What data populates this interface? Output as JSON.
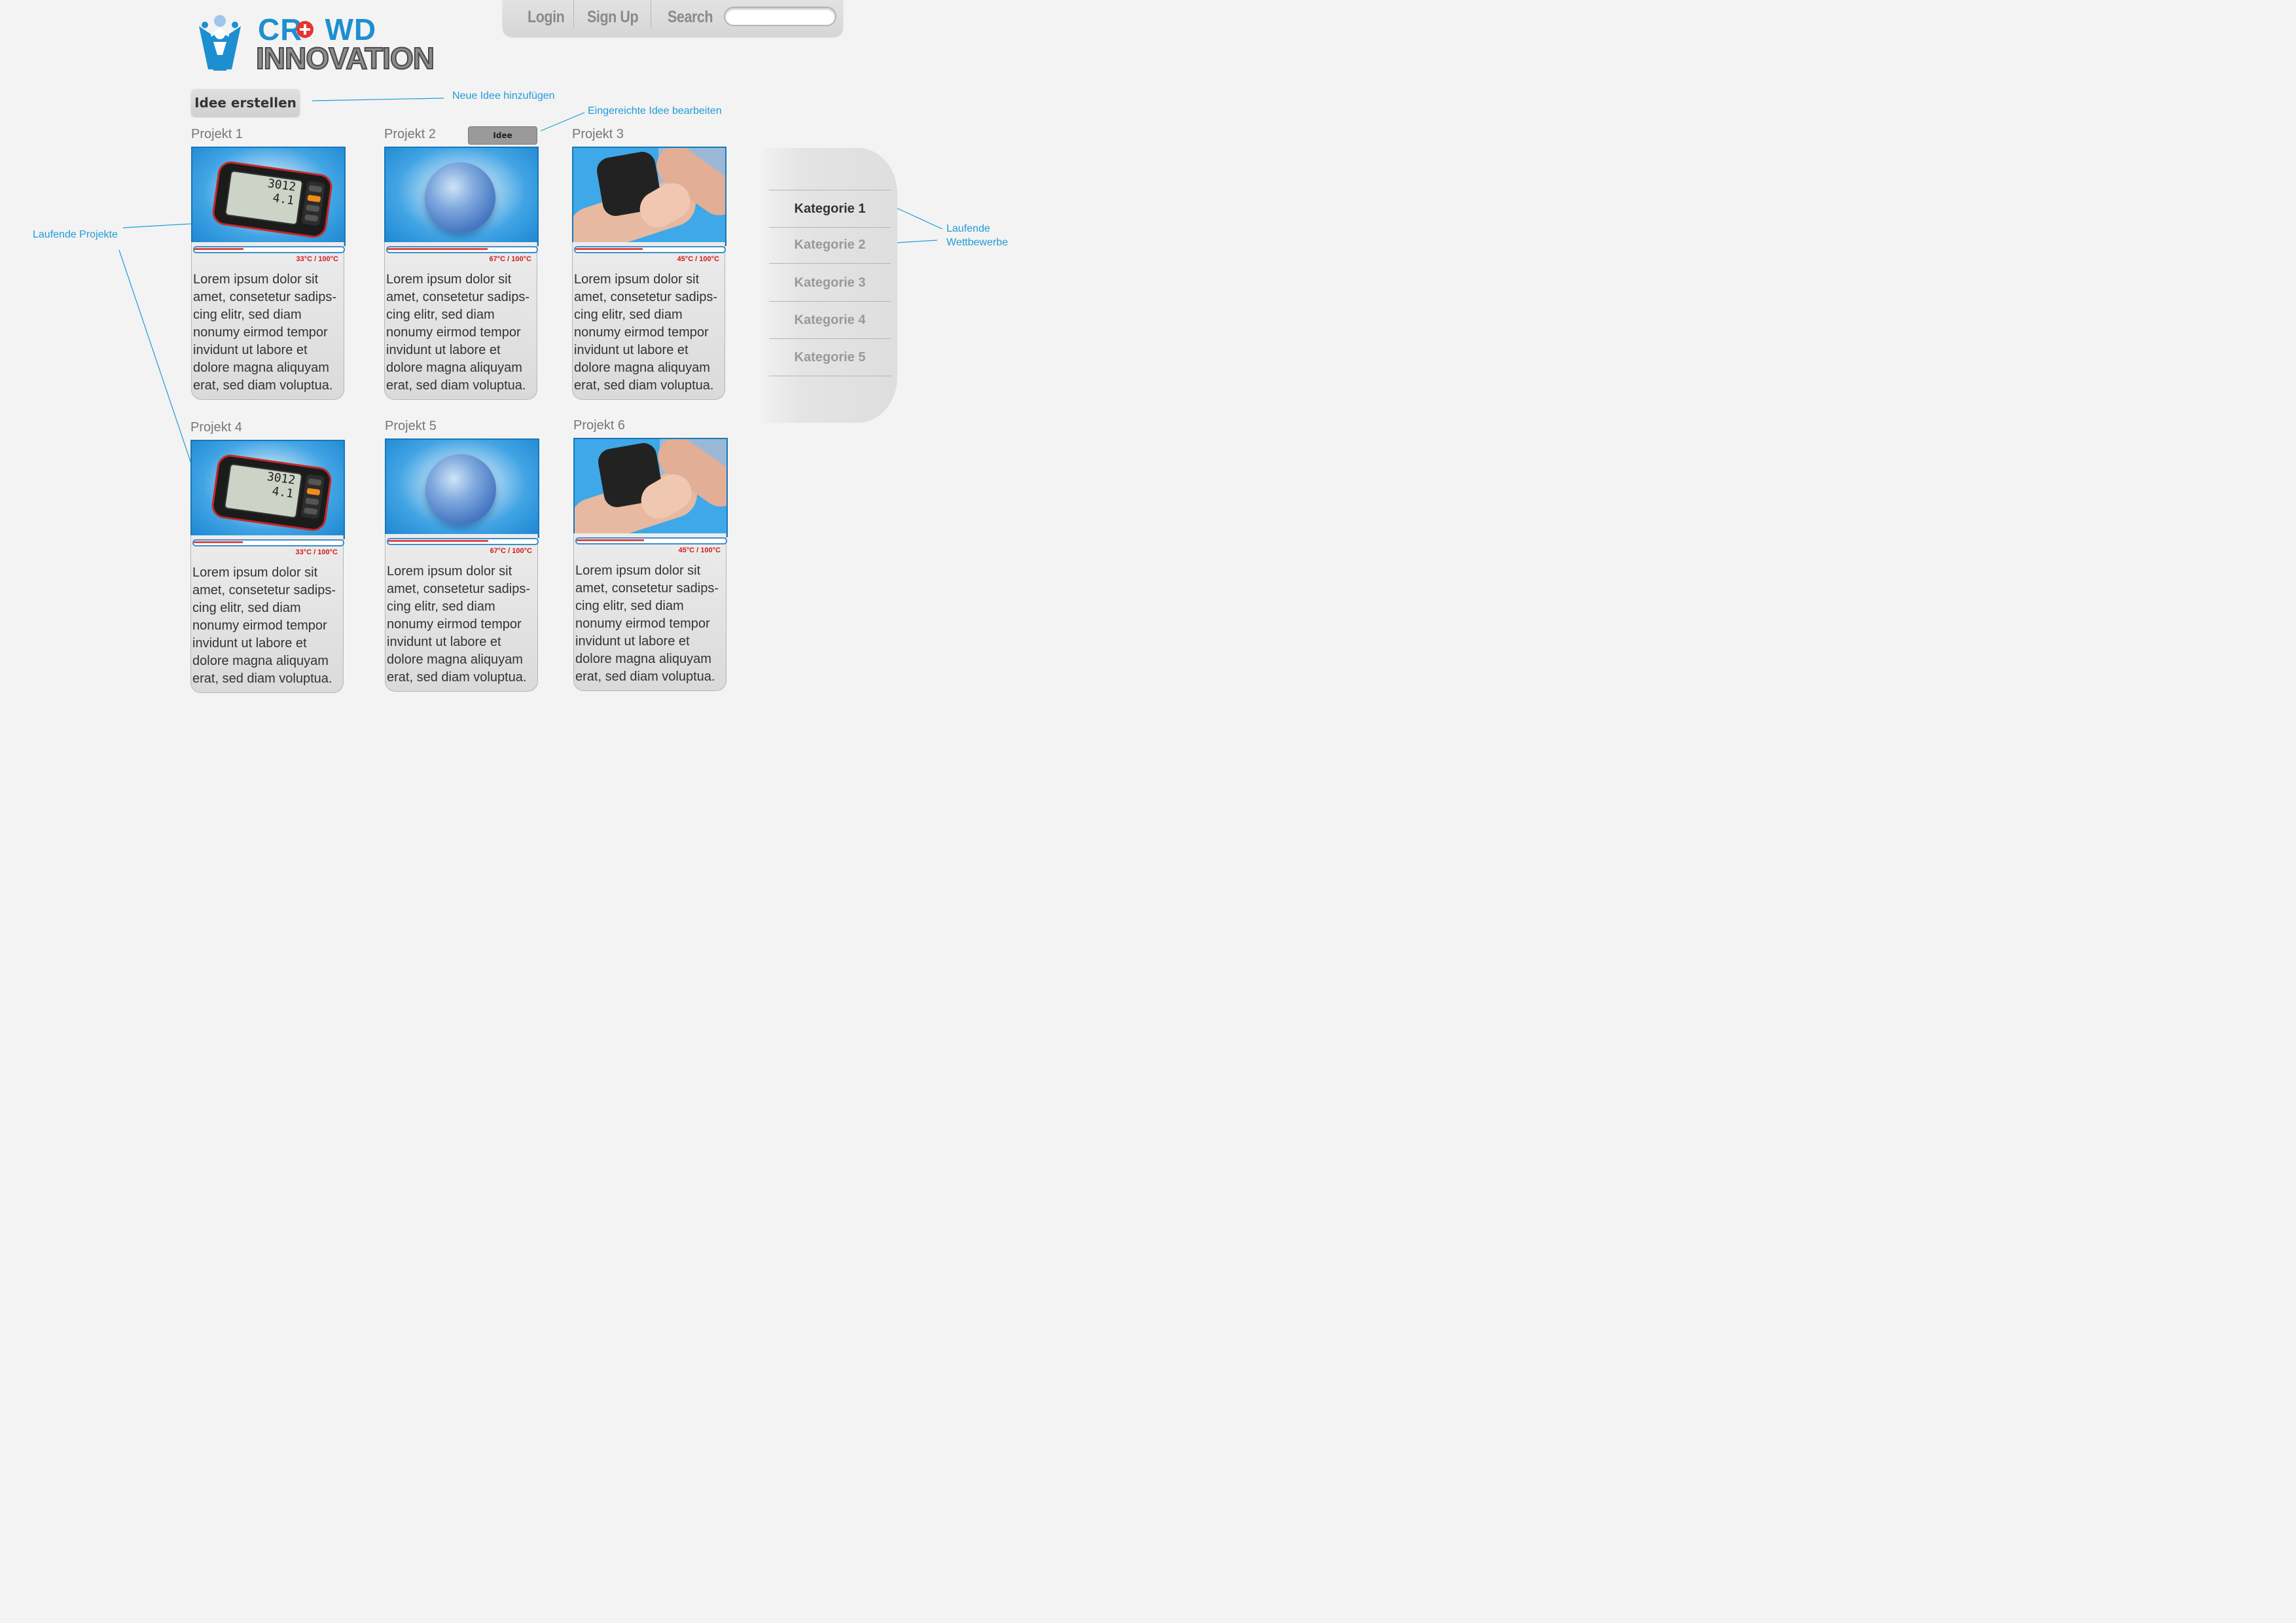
{
  "nav": {
    "login": "Login",
    "signup": "Sign Up",
    "search_label": "Search",
    "search_value": ""
  },
  "logo": {
    "line1": "CR",
    "line1b": "WD",
    "line2": "INNOVATION"
  },
  "actions": {
    "create_idea": "Idee erstellen",
    "edit_idea": "Idee bearbeiten"
  },
  "annotations": {
    "new_idea": "Neue Idee hinzufügen",
    "edit_submitted": "Eingereichte Idee bearbeiten",
    "running_projects": "Laufende Projekte",
    "running_competitions_1": "Laufende",
    "running_competitions_2": "Wettbewerbe"
  },
  "projects": [
    {
      "title": "Projekt 1",
      "image": "pedometer",
      "progress_label": "33°C  /  100°C",
      "progress": 0.33,
      "text": "Lorem ipsum dolor sit amet, consetetur sadips-cing elitr, sed diam nonumy eirmod tempor invidunt ut labore et dolore magna aliquyam erat, sed diam voluptua."
    },
    {
      "title": "Projekt 2",
      "image": "exercise-ball",
      "progress_label": "67°C  /  100°C",
      "progress": 0.67,
      "text": "Lorem ipsum dolor sit amet, consetetur sadips-cing elitr, sed diam nonumy eirmod tempor invidunt ut labore et dolore magna aliquyam erat, sed diam voluptua."
    },
    {
      "title": "Projekt 3",
      "image": "knee-brace",
      "progress_label": "45°C  /  100°C",
      "progress": 0.45,
      "text": "Lorem ipsum dolor sit amet, consetetur sadips-cing elitr, sed diam nonumy eirmod tempor invidunt ut labore et dolore magna aliquyam erat, sed diam voluptua."
    },
    {
      "title": "Projekt 4",
      "image": "pedometer",
      "progress_label": "33°C  /  100°C",
      "progress": 0.33,
      "text": "Lorem ipsum dolor sit amet, consetetur sadips-cing elitr, sed diam nonumy eirmod tempor invidunt ut labore et dolore magna aliquyam erat, sed diam voluptua."
    },
    {
      "title": "Projekt 5",
      "image": "exercise-ball",
      "progress_label": "67°C  /  100°C",
      "progress": 0.67,
      "text": "Lorem ipsum dolor sit amet, consetetur sadips-cing elitr, sed diam nonumy eirmod tempor invidunt ut labore et dolore magna aliquyam erat, sed diam voluptua."
    },
    {
      "title": "Projekt 6",
      "image": "knee-brace",
      "progress_label": "45°C  /  100°C",
      "progress": 0.45,
      "text": "Lorem ipsum dolor sit amet, consetetur sadips-cing elitr, sed diam nonumy eirmod tempor invidunt ut labore et dolore magna aliquyam erat, sed diam voluptua."
    }
  ],
  "pedometer_display": {
    "line1": "3012",
    "line2": "4.1"
  },
  "categories": [
    {
      "label": "Kategorie 1",
      "active": true
    },
    {
      "label": "Kategorie 2",
      "active": false
    },
    {
      "label": "Kategorie 3",
      "active": false
    },
    {
      "label": "Kategorie 4",
      "active": false
    },
    {
      "label": "Kategorie 5",
      "active": false
    }
  ],
  "colors": {
    "accent": "#1f9bd7",
    "progress": "#e04848",
    "progress_text": "#d11a1a"
  }
}
